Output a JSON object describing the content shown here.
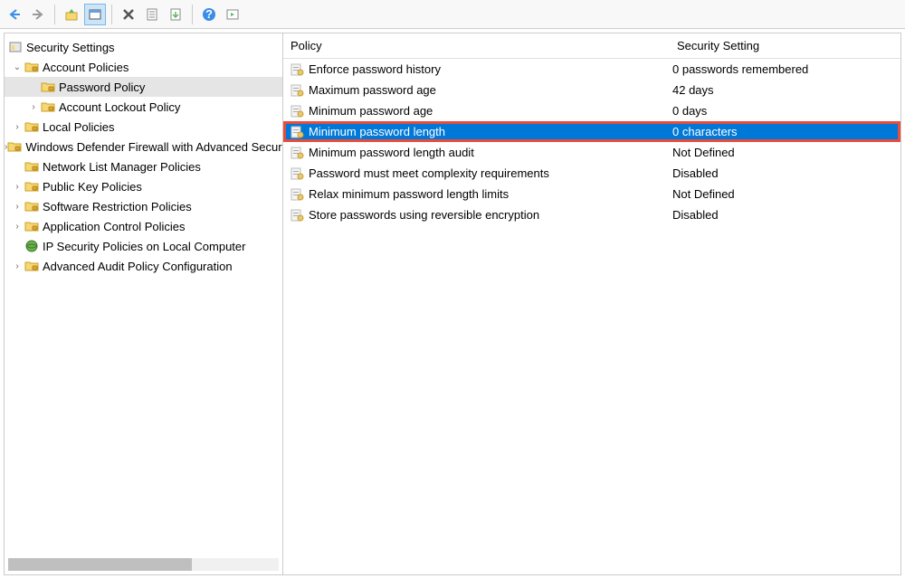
{
  "toolbar": {
    "back": "←",
    "forward": "→",
    "up": "↑",
    "show_hide": "⊞",
    "delete": "✕",
    "properties": "📋",
    "export": "📄",
    "help": "?",
    "action": "▸"
  },
  "tree": {
    "root_label": "Security Settings",
    "items": [
      {
        "label": "Account Policies",
        "depth": 1,
        "expanded": true
      },
      {
        "label": "Password Policy",
        "depth": 2,
        "selected": true
      },
      {
        "label": "Account Lockout Policy",
        "depth": 2,
        "has_children": true
      },
      {
        "label": "Local Policies",
        "depth": 1,
        "has_children": true
      },
      {
        "label": "Windows Defender Firewall with Advanced Security",
        "depth": 1,
        "has_children": true
      },
      {
        "label": "Network List Manager Policies",
        "depth": 1
      },
      {
        "label": "Public Key Policies",
        "depth": 1,
        "has_children": true
      },
      {
        "label": "Software Restriction Policies",
        "depth": 1,
        "has_children": true
      },
      {
        "label": "Application Control Policies",
        "depth": 1,
        "has_children": true
      },
      {
        "label": "IP Security Policies on Local Computer",
        "depth": 1,
        "globe": true
      },
      {
        "label": "Advanced Audit Policy Configuration",
        "depth": 1,
        "has_children": true
      }
    ]
  },
  "list": {
    "col_policy": "Policy",
    "col_setting": "Security Setting",
    "rows": [
      {
        "policy": "Enforce password history",
        "setting": "0 passwords remembered"
      },
      {
        "policy": "Maximum password age",
        "setting": "42 days"
      },
      {
        "policy": "Minimum password age",
        "setting": "0 days"
      },
      {
        "policy": "Minimum password length",
        "setting": "0 characters",
        "selected": true,
        "highlighted": true
      },
      {
        "policy": "Minimum password length audit",
        "setting": "Not Defined"
      },
      {
        "policy": "Password must meet complexity requirements",
        "setting": "Disabled"
      },
      {
        "policy": "Relax minimum password length limits",
        "setting": "Not Defined"
      },
      {
        "policy": "Store passwords using reversible encryption",
        "setting": "Disabled"
      }
    ]
  }
}
